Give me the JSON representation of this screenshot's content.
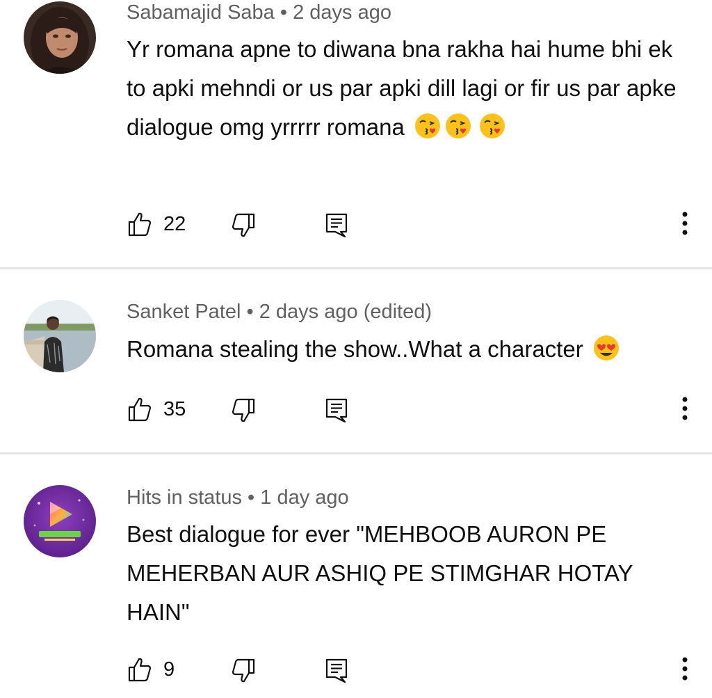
{
  "comments": [
    {
      "author": "Sabamajid Saba",
      "time": "2 days ago",
      "edited": "",
      "text": "Yr romana apne to diwana bna rakha hai hume bhi ek to apki mehndi or us par apki dill lagi or fir us par apke dialogue omg yrrrrr romana",
      "emojis": [
        "face-blowing-kiss",
        "face-blowing-kiss",
        "face-blowing-kiss"
      ],
      "likes": "22"
    },
    {
      "author": "Sanket Patel",
      "time": "2 days ago",
      "edited": "(edited)",
      "text": "Romana stealing the show..What a character",
      "emojis": [
        "heart-eyes"
      ],
      "likes": "35"
    },
    {
      "author": "Hits in status",
      "time": "1 day ago",
      "edited": "",
      "text": "Best dialogue for ever \"MEHBOOB AURON PE MEHERBAN AUR ASHIQ PE STIMGHAR HOTAY HAIN\"",
      "emojis": [],
      "likes": "9",
      "avatar_text": "HITS IN STATUS"
    }
  ],
  "separator": " • ",
  "icons": {
    "like": "thumbs-up-icon",
    "dislike": "thumbs-down-icon",
    "reply": "reply-icon",
    "more": "more-vert-icon"
  },
  "colors": {
    "text": "#0f0f0f",
    "meta": "#606060",
    "divider": "#e5e5e5",
    "emoji": "#fcc21b"
  }
}
